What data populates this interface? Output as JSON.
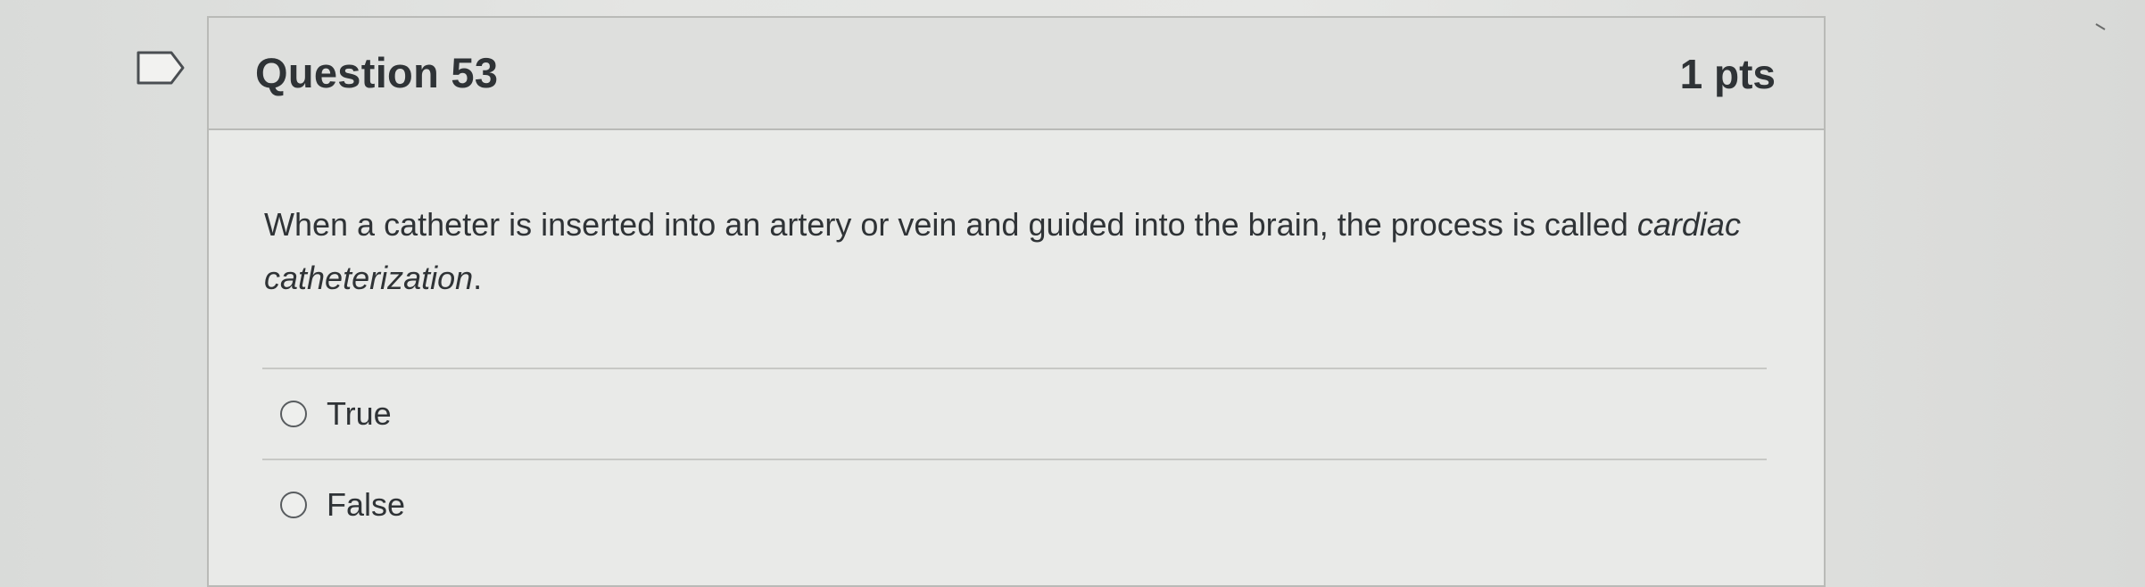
{
  "question": {
    "title": "Question 53",
    "points": "1 pts",
    "text_before": "When a catheter is inserted into an artery or vein and guided into the brain, the process is called ",
    "text_emphasis": "cardiac catheterization",
    "text_after": "."
  },
  "answers": [
    {
      "label": "True",
      "selected": false
    },
    {
      "label": "False",
      "selected": false
    }
  ],
  "icons": {
    "flag": "flag-question-icon",
    "radio": "radio-unselected-icon"
  },
  "colors": {
    "text": "#2f3336",
    "border": "#b9bab7",
    "header_bg": "#dedfdd"
  }
}
